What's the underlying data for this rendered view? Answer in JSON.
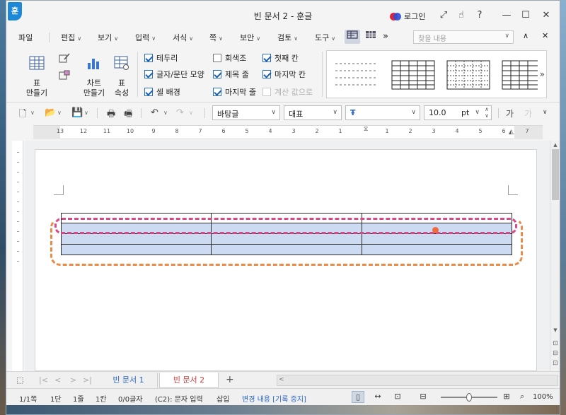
{
  "window": {
    "title": "빈 문서 2 - 훈글",
    "app_logo": "훈",
    "login_label": "로그인"
  },
  "menu": {
    "items": [
      "파일",
      "편집",
      "보기",
      "입력",
      "서식",
      "쪽",
      "보안",
      "검토",
      "도구"
    ],
    "more": "»",
    "search_placeholder": "찾을 내용"
  },
  "ribbon": {
    "table_label": "표\n만들기",
    "table_label_line1": "표",
    "table_label_line2": "만들기",
    "chart_label_line1": "차트",
    "chart_label_line2": "만들기",
    "props_label_line1": "표",
    "props_label_line2": "속성",
    "checks": [
      {
        "label": "테두리",
        "checked": true
      },
      {
        "label": "글자/문단 모양",
        "checked": true
      },
      {
        "label": "셀 배경",
        "checked": true
      },
      {
        "label": "회색조",
        "checked": false
      },
      {
        "label": "제목 줄",
        "checked": true
      },
      {
        "label": "마지막 줄",
        "checked": true
      },
      {
        "label": "첫째 칸",
        "checked": true
      },
      {
        "label": "마지막 칸",
        "checked": true
      },
      {
        "label": "계산 값으로",
        "checked": false,
        "disabled": true
      }
    ]
  },
  "toolbar2": {
    "style_value": "바탕글",
    "font_group_value": "대표",
    "font_name_value": "",
    "font_size_value": "10.0",
    "font_size_unit": "pt",
    "char_icon": "가"
  },
  "ruler": {
    "numbers": [
      "13",
      "12",
      "11",
      "10",
      "9",
      "8",
      "7",
      "6",
      "5",
      "4",
      "3",
      "2",
      "1",
      "",
      "1",
      "2",
      "3",
      "4",
      "5",
      "6",
      "7"
    ]
  },
  "tabs": {
    "items": [
      {
        "label": "빈 문서 1",
        "active": false
      },
      {
        "label": "빈 문서 2",
        "active": true
      }
    ],
    "add": "+"
  },
  "status": {
    "page": "1/1쪽",
    "section": "1단",
    "line": "1줄",
    "column": "1칸",
    "chars": "0/0글자",
    "mode": "(C2): 문자 입력",
    "insert": "삽입",
    "track": "변경 내용 [기록 중지]",
    "zoom": "100%"
  },
  "colors": {
    "accent": "#1e88d8",
    "table_fill": "#ccdaf2",
    "pink_annotation": "#d64a8a",
    "orange_annotation": "#e98b4a",
    "marker": "#f06a3c",
    "active_tab": "#d83a3a",
    "link_blue": "#2a66c8"
  }
}
